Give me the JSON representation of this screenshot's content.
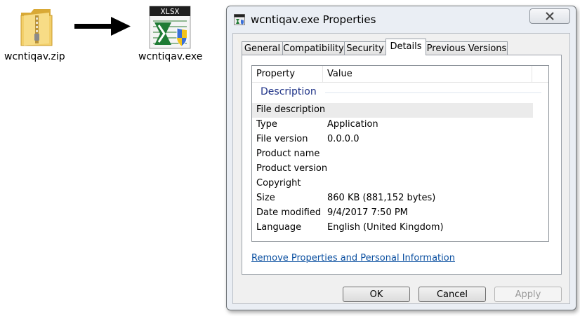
{
  "desktop": {
    "zip_label": "wcntiqav.zip",
    "exe_label": "wcntiqav.exe",
    "exe_icon_text": "XLSX"
  },
  "dialog": {
    "title": "wcntiqav.exe Properties",
    "tabs": [
      {
        "label": "General",
        "active": false
      },
      {
        "label": "Compatibility",
        "active": false
      },
      {
        "label": "Security",
        "active": false
      },
      {
        "label": "Details",
        "active": true
      },
      {
        "label": "Previous Versions",
        "active": false
      }
    ],
    "columns": {
      "property": "Property",
      "value": "Value"
    },
    "group": "Description",
    "rows": [
      {
        "property": "File description",
        "value": ""
      },
      {
        "property": "Type",
        "value": "Application"
      },
      {
        "property": "File version",
        "value": "0.0.0.0"
      },
      {
        "property": "Product name",
        "value": ""
      },
      {
        "property": "Product version",
        "value": ""
      },
      {
        "property": "Copyright",
        "value": ""
      },
      {
        "property": "Size",
        "value": "860 KB (881,152 bytes)"
      },
      {
        "property": "Date modified",
        "value": "9/4/2017 7:50 PM"
      },
      {
        "property": "Language",
        "value": "English (United Kingdom)"
      }
    ],
    "link": "Remove Properties and Personal Information",
    "buttons": {
      "ok": "OK",
      "cancel": "Cancel",
      "apply": "Apply"
    }
  },
  "colors": {
    "link": "#0a4fa0",
    "group_header": "#1e3287"
  }
}
